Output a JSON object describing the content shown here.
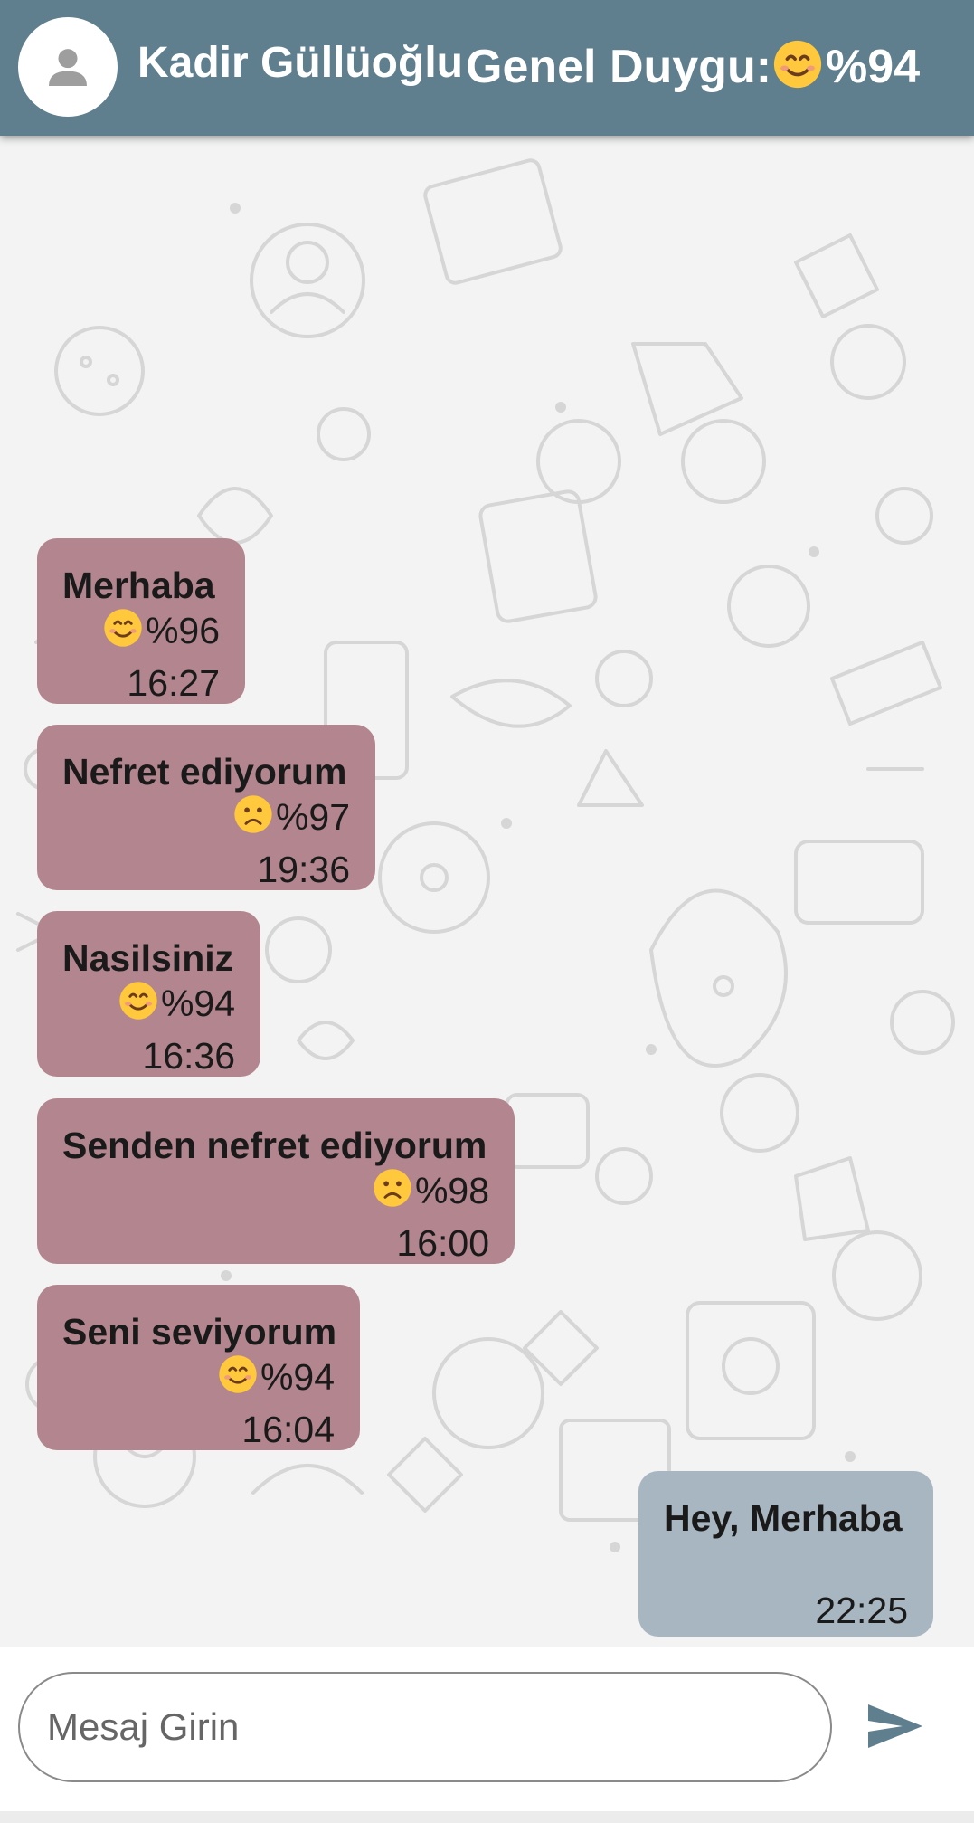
{
  "header": {
    "contact_name": "Kadir Güllüoğlu",
    "mood_label": "Genel Duygu:",
    "mood_emoji": "happy-face-icon",
    "mood_value": "%94"
  },
  "messages": [
    {
      "direction": "incoming",
      "text": "Merhaba",
      "emotion": "happy-face-icon",
      "score": "%96",
      "time": "16:27"
    },
    {
      "direction": "incoming",
      "text": "Nefret ediyorum",
      "emotion": "sad-face-icon",
      "score": "%97",
      "time": "19:36"
    },
    {
      "direction": "incoming",
      "text": "Nasilsiniz",
      "emotion": "happy-face-icon",
      "score": "%94",
      "time": "16:36"
    },
    {
      "direction": "incoming",
      "text": "Senden nefret ediyorum",
      "emotion": "sad-face-icon",
      "score": "%98",
      "time": "16:00"
    },
    {
      "direction": "incoming",
      "text": "Seni seviyorum",
      "emotion": "happy-face-icon",
      "score": "%94",
      "time": "16:04"
    },
    {
      "direction": "outgoing",
      "text": "Hey, Merhaba",
      "time": "22:25"
    }
  ],
  "composer": {
    "placeholder": "Mesaj Girin",
    "send_icon": "send-icon"
  },
  "colors": {
    "header": "#5f7e8e",
    "incoming_bubble": "#b2858f",
    "outgoing_bubble": "#a8b6c1"
  }
}
